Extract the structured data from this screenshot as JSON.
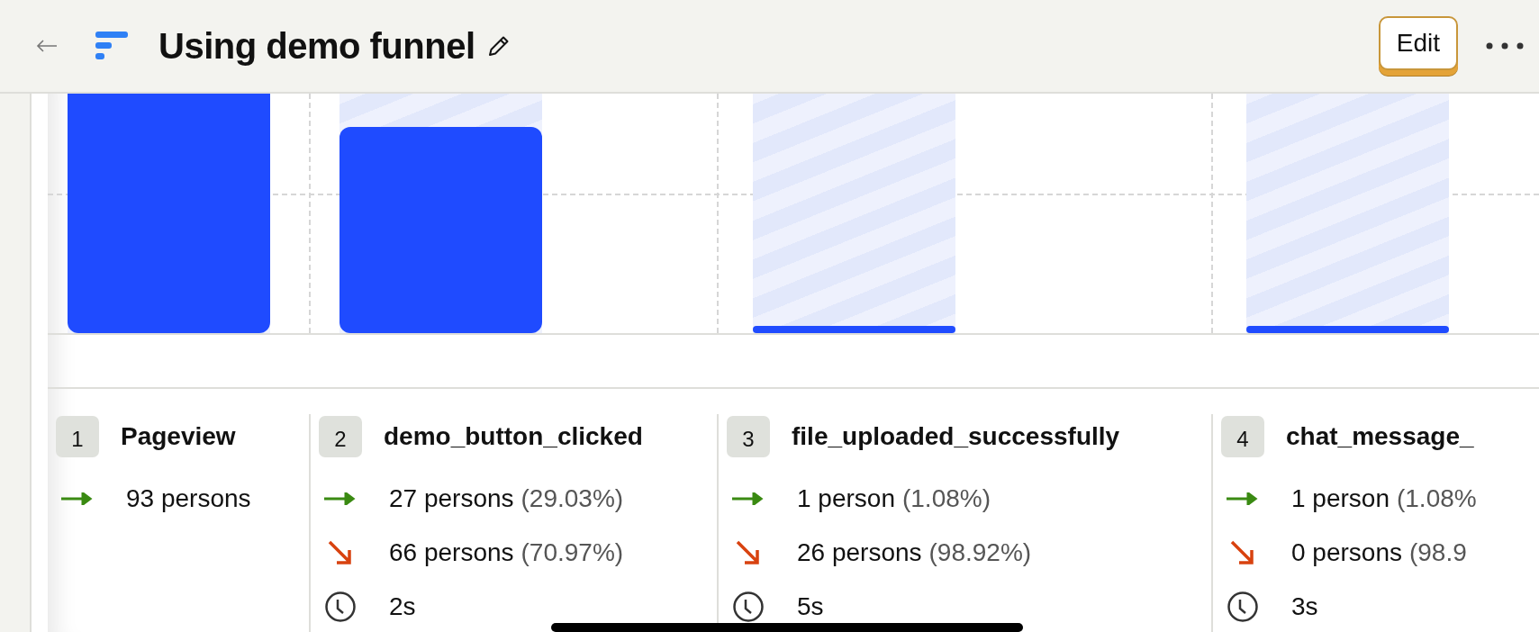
{
  "header": {
    "title": "Using demo funnel",
    "edit_button": "Edit"
  },
  "steps": [
    {
      "number": "1",
      "name": "Pageview",
      "level": 1,
      "converted": "93 persons"
    },
    {
      "number": "2",
      "name": "demo_button_clicked",
      "level": 0.86,
      "converted": "27 persons",
      "converted_pct": "(29.03%)",
      "dropped": "66 persons",
      "dropped_pct": "(70.97%)",
      "time": "2s"
    },
    {
      "number": "3",
      "name": "file_uploaded_successfully",
      "level": 0.03,
      "converted": "1 person",
      "converted_pct": "(1.08%)",
      "dropped": "26 persons",
      "dropped_pct": "(98.92%)",
      "time": "5s"
    },
    {
      "number": "4",
      "name": "chat_message_",
      "level": 0.03,
      "converted": "1 person",
      "converted_pct": "(1.08%",
      "dropped": "0 persons",
      "dropped_pct": "(98.9",
      "time": "3s"
    }
  ]
}
